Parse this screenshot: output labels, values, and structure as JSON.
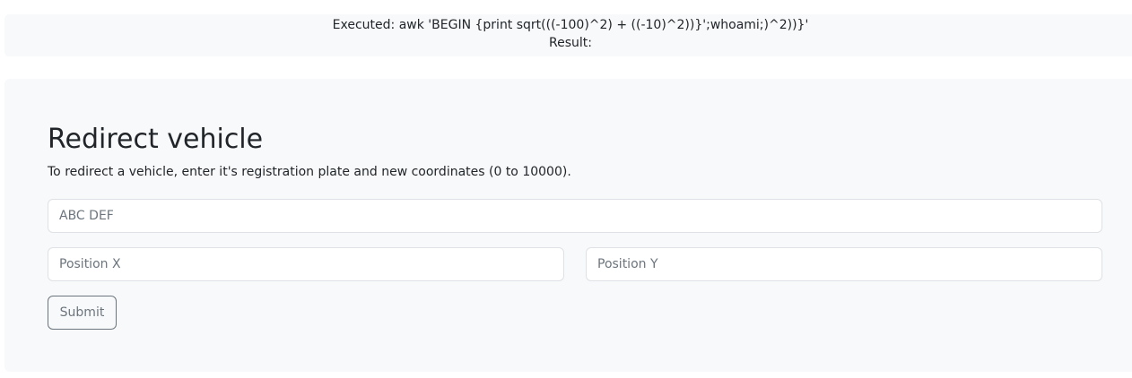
{
  "result_box": {
    "executed": "Executed: awk 'BEGIN {print sqrt(((-100)^2) + ((-10)^2))}';whoami;)^2))}'",
    "result": "Result:"
  },
  "form": {
    "title": "Redirect vehicle",
    "description": "To redirect a vehicle, enter it's registration plate and new coordinates (0 to 10000).",
    "plate_placeholder": "ABC DEF",
    "x_placeholder": "Position X",
    "y_placeholder": "Position Y",
    "submit_label": "Submit"
  }
}
